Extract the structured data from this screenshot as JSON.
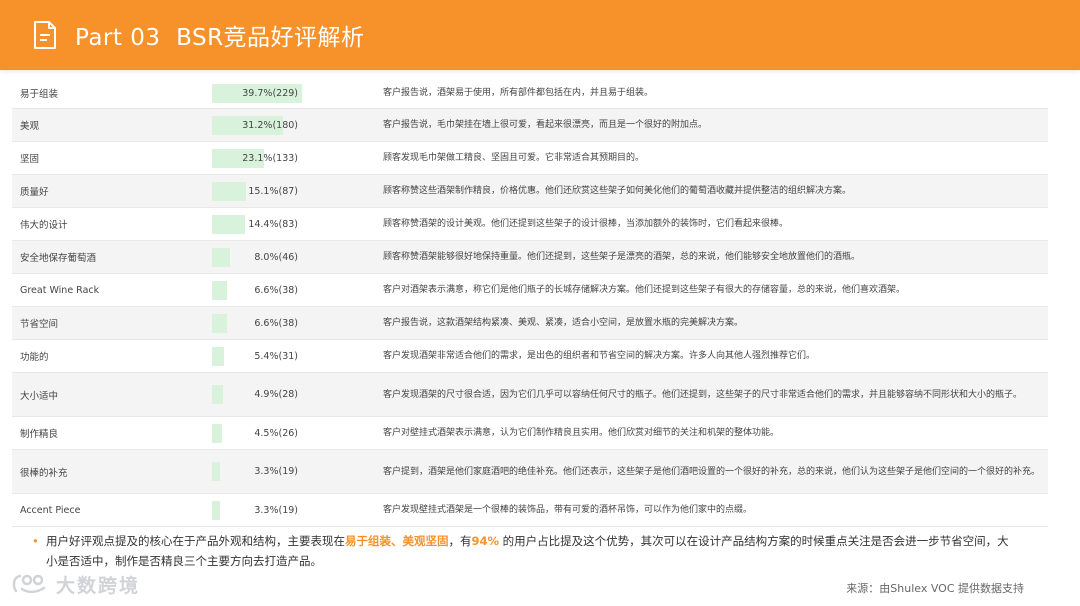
{
  "header": {
    "title": "Part 03  BSR竞品好评解析"
  },
  "rows": [
    {
      "name": "易于组装",
      "pct": "39.7%(229)",
      "value": 39.7,
      "desc": "客户报告说，酒架易于使用，所有部件都包括在内，并且易于组装。"
    },
    {
      "name": "美观",
      "pct": "31.2%(180)",
      "value": 31.2,
      "desc": "客户报告说，毛巾架挂在墙上很可爱，看起来很漂亮，而且是一个很好的附加点。"
    },
    {
      "name": "坚固",
      "pct": "23.1%(133)",
      "value": 23.1,
      "desc": "顾客发现毛巾架做工精良、坚固且可爱。它非常适合其预期目的。"
    },
    {
      "name": "质量好",
      "pct": "15.1%(87)",
      "value": 15.1,
      "desc": "顾客称赞这些酒架制作精良，价格优惠。他们还欣赏这些架子如何美化他们的葡萄酒收藏并提供整洁的组织解决方案。"
    },
    {
      "name": "伟大的设计",
      "pct": "14.4%(83)",
      "value": 14.4,
      "desc": "顾客称赞酒架的设计美观。他们还提到这些架子的设计很棒，当添加额外的装饰时，它们看起来很棒。"
    },
    {
      "name": "安全地保存葡萄酒",
      "pct": "8.0%(46)",
      "value": 8.0,
      "desc": "顾客称赞酒架能够很好地保持重量。他们还提到，这些架子是漂亮的酒架，总的来说，他们能够安全地放置他们的酒瓶。"
    },
    {
      "name": "Great Wine Rack",
      "pct": "6.6%(38)",
      "value": 6.6,
      "desc": "客户对酒架表示满意，称它们是他们瓶子的长城存储解决方案。他们还提到这些架子有很大的存储容量，总的来说，他们喜欢酒架。"
    },
    {
      "name": "节省空间",
      "pct": "6.6%(38)",
      "value": 6.6,
      "desc": "客户报告说，这款酒架结构紧凑、美观、紧凑，适合小空间，是放置水瓶的完美解决方案。"
    },
    {
      "name": "功能的",
      "pct": "5.4%(31)",
      "value": 5.4,
      "desc": "客户发现酒架非常适合他们的需求，是出色的组织者和节省空间的解决方案。许多人向其他人强烈推荐它们。"
    },
    {
      "name": "大小适中",
      "pct": "4.9%(28)",
      "value": 4.9,
      "desc": "客户发现酒架的尺寸很合适，因为它们几乎可以容纳任何尺寸的瓶子。他们还提到，这些架子的尺寸非常适合他们的需求，并且能够容纳不同形状和大小的瓶子。"
    },
    {
      "name": "制作精良",
      "pct": "4.5%(26)",
      "value": 4.5,
      "desc": "客户对壁挂式酒架表示满意，认为它们制作精良且实用。他们欣赏对细节的关注和机架的整体功能。"
    },
    {
      "name": "很棒的补充",
      "pct": "3.3%(19)",
      "value": 3.3,
      "desc": "客户提到，酒架是他们家庭酒吧的绝佳补充。他们还表示，这些架子是他们酒吧设置的一个很好的补充，总的来说，他们认为这些架子是他们空间的一个很好的补充。"
    },
    {
      "name": "Accent Piece",
      "pct": "3.3%(19)",
      "value": 3.3,
      "desc": "客户发现壁挂式酒架是一个很棒的装饰品，带有可爱的酒杯吊饰，可以作为他们家中的点缀。"
    }
  ],
  "summary": {
    "bullet": "•",
    "part1": "用户好评观点提及的核心在于产品外观和结构，主要表现在",
    "highlight1": "易于组装、美观坚固",
    "part2": "，有",
    "highlight2": "94%",
    "part3": " 的用户占比提及这个优势，其次可以在设计产品结构方案的时候重点关注是否会进一步节省空间，大小是否适中，制作是否精良三个主要方向去打造产品。"
  },
  "footer": {
    "logo_text": "大数跨境",
    "source": "来源：由Shulex VOC 提供数据支持"
  },
  "colors": {
    "accent": "#f7922a",
    "bar": "#d9f2dc",
    "alt_row": "#f4f4f4"
  }
}
